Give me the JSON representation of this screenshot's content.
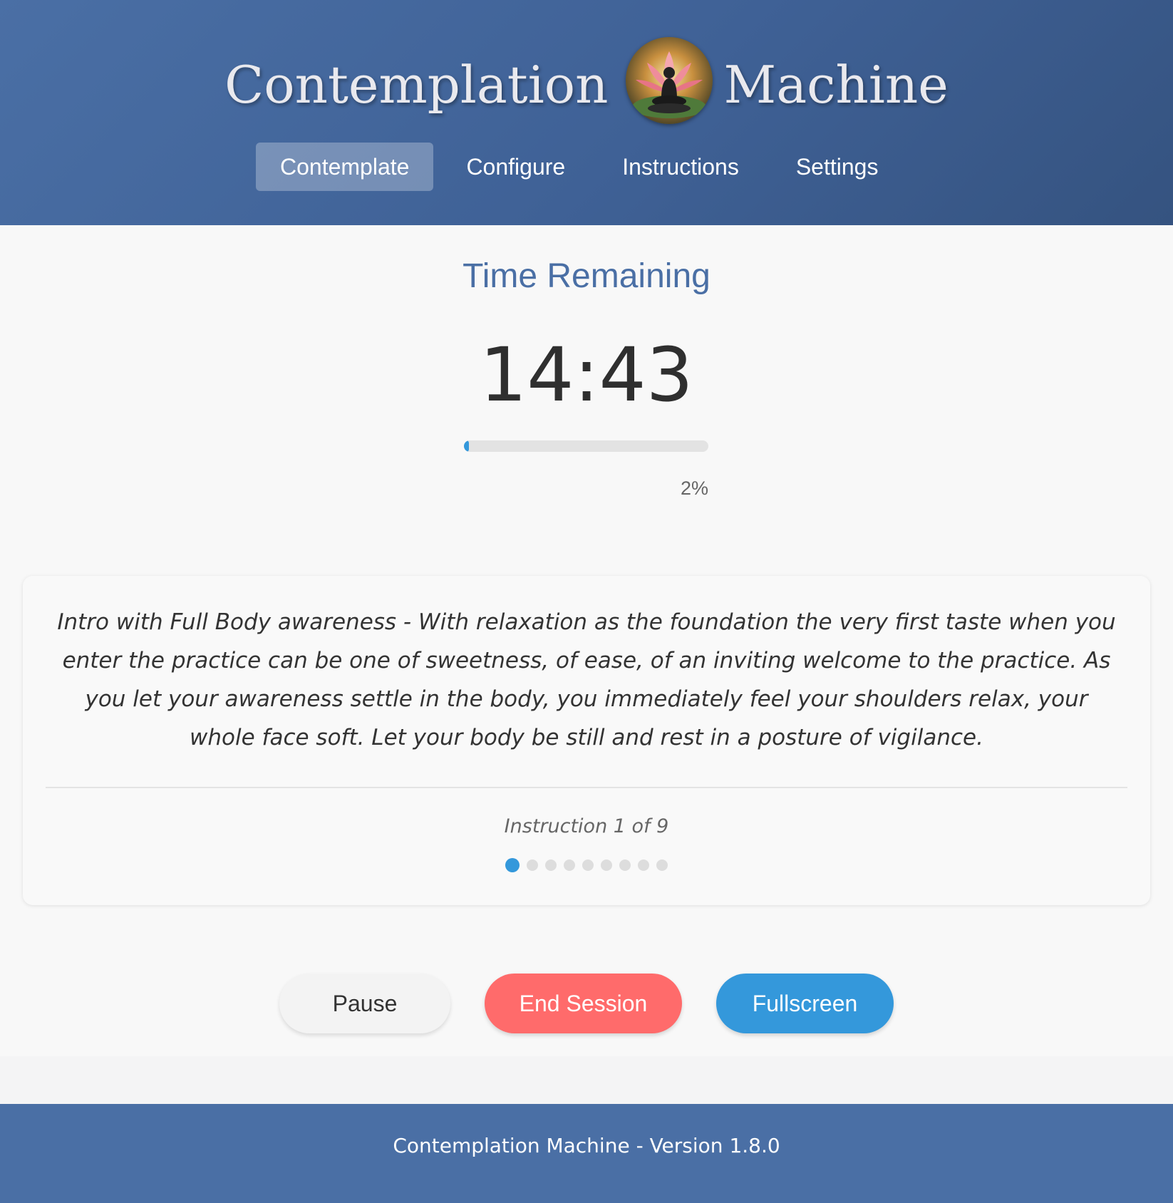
{
  "header": {
    "title_left": "Contemplation",
    "title_right": "Machine",
    "logo_icon": "lotus-buddha-icon"
  },
  "nav": {
    "items": [
      {
        "label": "Contemplate",
        "active": true
      },
      {
        "label": "Configure",
        "active": false
      },
      {
        "label": "Instructions",
        "active": false
      },
      {
        "label": "Settings",
        "active": false
      }
    ]
  },
  "timer": {
    "label": "Time Remaining",
    "value": "14:43",
    "progress_percent": 2,
    "progress_text": "2%"
  },
  "instruction": {
    "text": "Intro with Full Body awareness - With relaxation as the foundation the very first taste when you enter the practice can be one of sweetness, of ease, of an inviting welcome to the practice. As you let your aware­ness settle in the body, you immediately feel your shoulders relax, your whole face soft. Let your body be still and rest in a posture of vigilance.",
    "count_text": "Instruction 1 of 9",
    "current": 1,
    "total": 9
  },
  "controls": {
    "pause_label": "Pause",
    "end_label": "End Session",
    "fullscreen_label": "Fullscreen"
  },
  "footer": {
    "text": "Contemplation Machine - Version 1.8.0"
  },
  "colors": {
    "brand": "#4a6fa5",
    "accent": "#3498db",
    "danger": "#ff6b6b"
  }
}
